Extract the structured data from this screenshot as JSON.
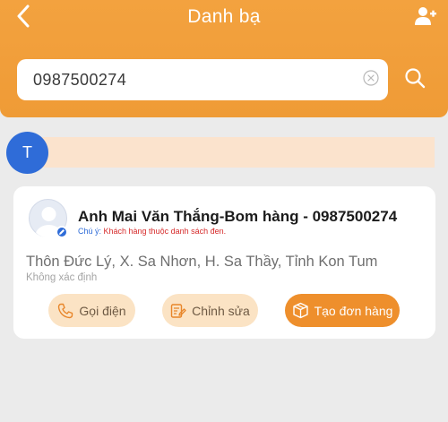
{
  "header": {
    "title": "Danh bạ"
  },
  "search": {
    "value": "0987500274"
  },
  "section": {
    "letter": "T"
  },
  "contact": {
    "name": "Anh Mai Văn Thắng-Bom hàng - 0987500274",
    "note_label": "Chú ý: ",
    "note_text": "Khách hàng thuộc danh sách đen.",
    "address": "Thôn Đức Lý, X. Sa Nhơn, H. Sa Thầy, Tỉnh Kon Tum",
    "sub_address": "Không xác định"
  },
  "actions": {
    "call_label": "Gọi điện",
    "edit_label": "Chỉnh sửa",
    "order_label": "Tạo đơn hàng"
  },
  "colors": {
    "header": "#ef9b36",
    "badge": "#2f6cd8",
    "warning": "#d62b2b",
    "primary_button": "#ee8f2c",
    "secondary_button": "#fbe3c4"
  },
  "icons": {
    "back": "chevron-left-icon",
    "add_user": "add-user-icon",
    "clear": "clear-circle-icon",
    "search": "search-icon",
    "call": "phone-icon",
    "edit": "edit-icon",
    "order": "package-icon"
  }
}
